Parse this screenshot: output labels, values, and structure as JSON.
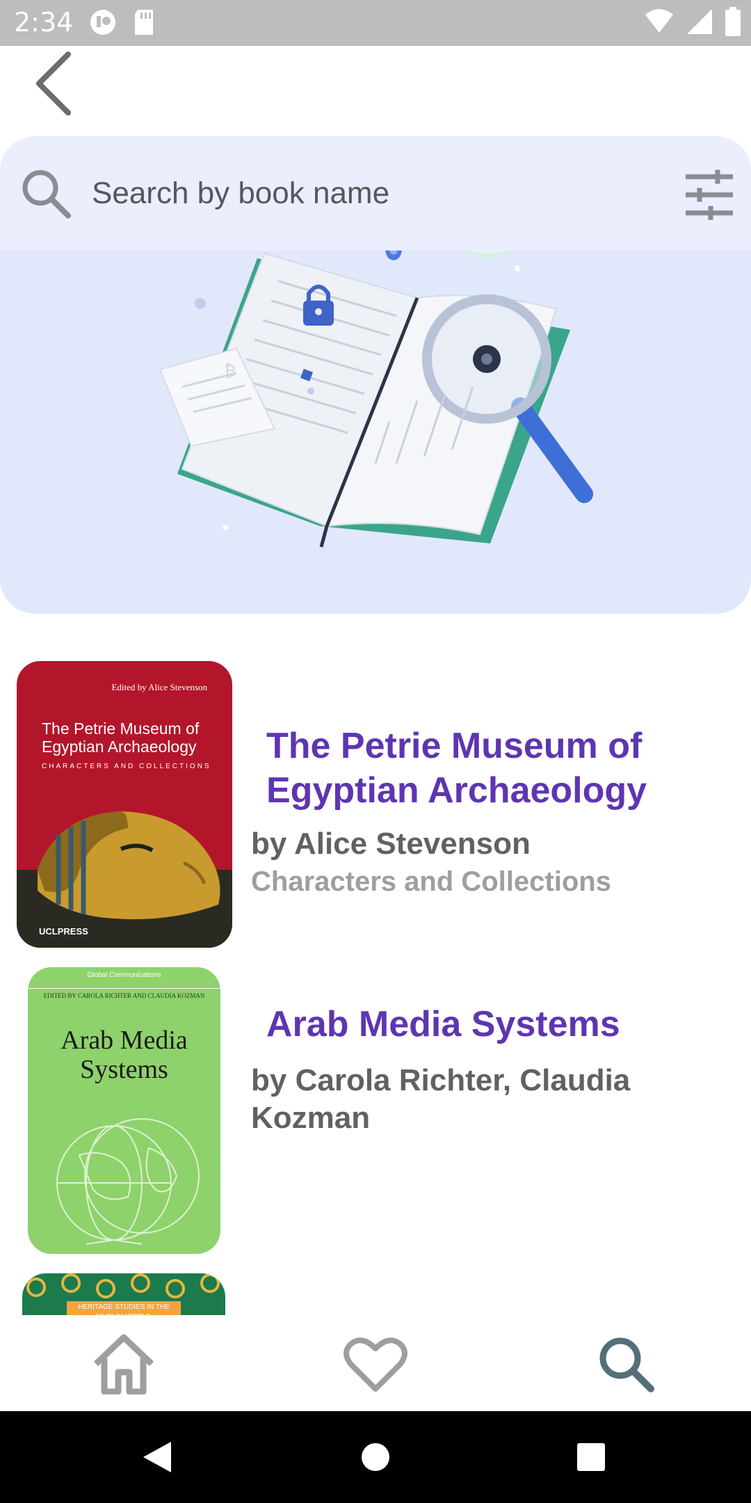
{
  "status_bar": {
    "time": "2:34",
    "left_icons": [
      "notification-badge-icon",
      "sd-card-icon"
    ],
    "right_icons": [
      "wifi-icon",
      "signal-icon",
      "battery-icon"
    ]
  },
  "top_bar": {
    "back_icon": "chevron-left-icon"
  },
  "search": {
    "placeholder": "Search by book name",
    "icon": "search-icon",
    "filter_icon": "tune-icon"
  },
  "books": [
    {
      "title": "The Petrie Museum of Egyptian Archaeology",
      "title_lines": [
        "The Petrie Museum of",
        "Egyptian Archaeology"
      ],
      "author": "by Alice Stevenson",
      "subtitle": "Characters and Collections",
      "cover": {
        "editor_line": "Edited by Alice Stevenson",
        "title_lines": [
          "The Petrie Museum of",
          "Egyptian Archaeology"
        ],
        "subtitle": "CHARACTERS AND COLLECTIONS",
        "publisher": "UCLPRESS",
        "color": "#b3162a"
      }
    },
    {
      "title": "Arab Media Systems",
      "author_lines": [
        "by Carola Richter, Claudia",
        "Kozman"
      ],
      "cover": {
        "series": "Global Communications",
        "editor_line": "EDITED BY CAROLA RICHTER AND CLAUDIA KOZMAN",
        "title_lines": [
          "Arab Media",
          "Systems"
        ],
        "color": "#8ed26c"
      }
    },
    {
      "cover": {
        "band_text": "HERITAGE STUDIES IN THE MUSLIM WORLD",
        "color": "#1c7a4c"
      }
    }
  ],
  "bottom_nav": {
    "items": [
      "home-icon",
      "heart-icon",
      "search-icon"
    ],
    "active": "search-icon"
  },
  "colors": {
    "accent": "#5e35b1",
    "hero_bg": "#e2e8fb",
    "search_bg": "#eaeefd",
    "nav_active": "#546e7a",
    "nav_inactive": "#9e9e9e"
  }
}
